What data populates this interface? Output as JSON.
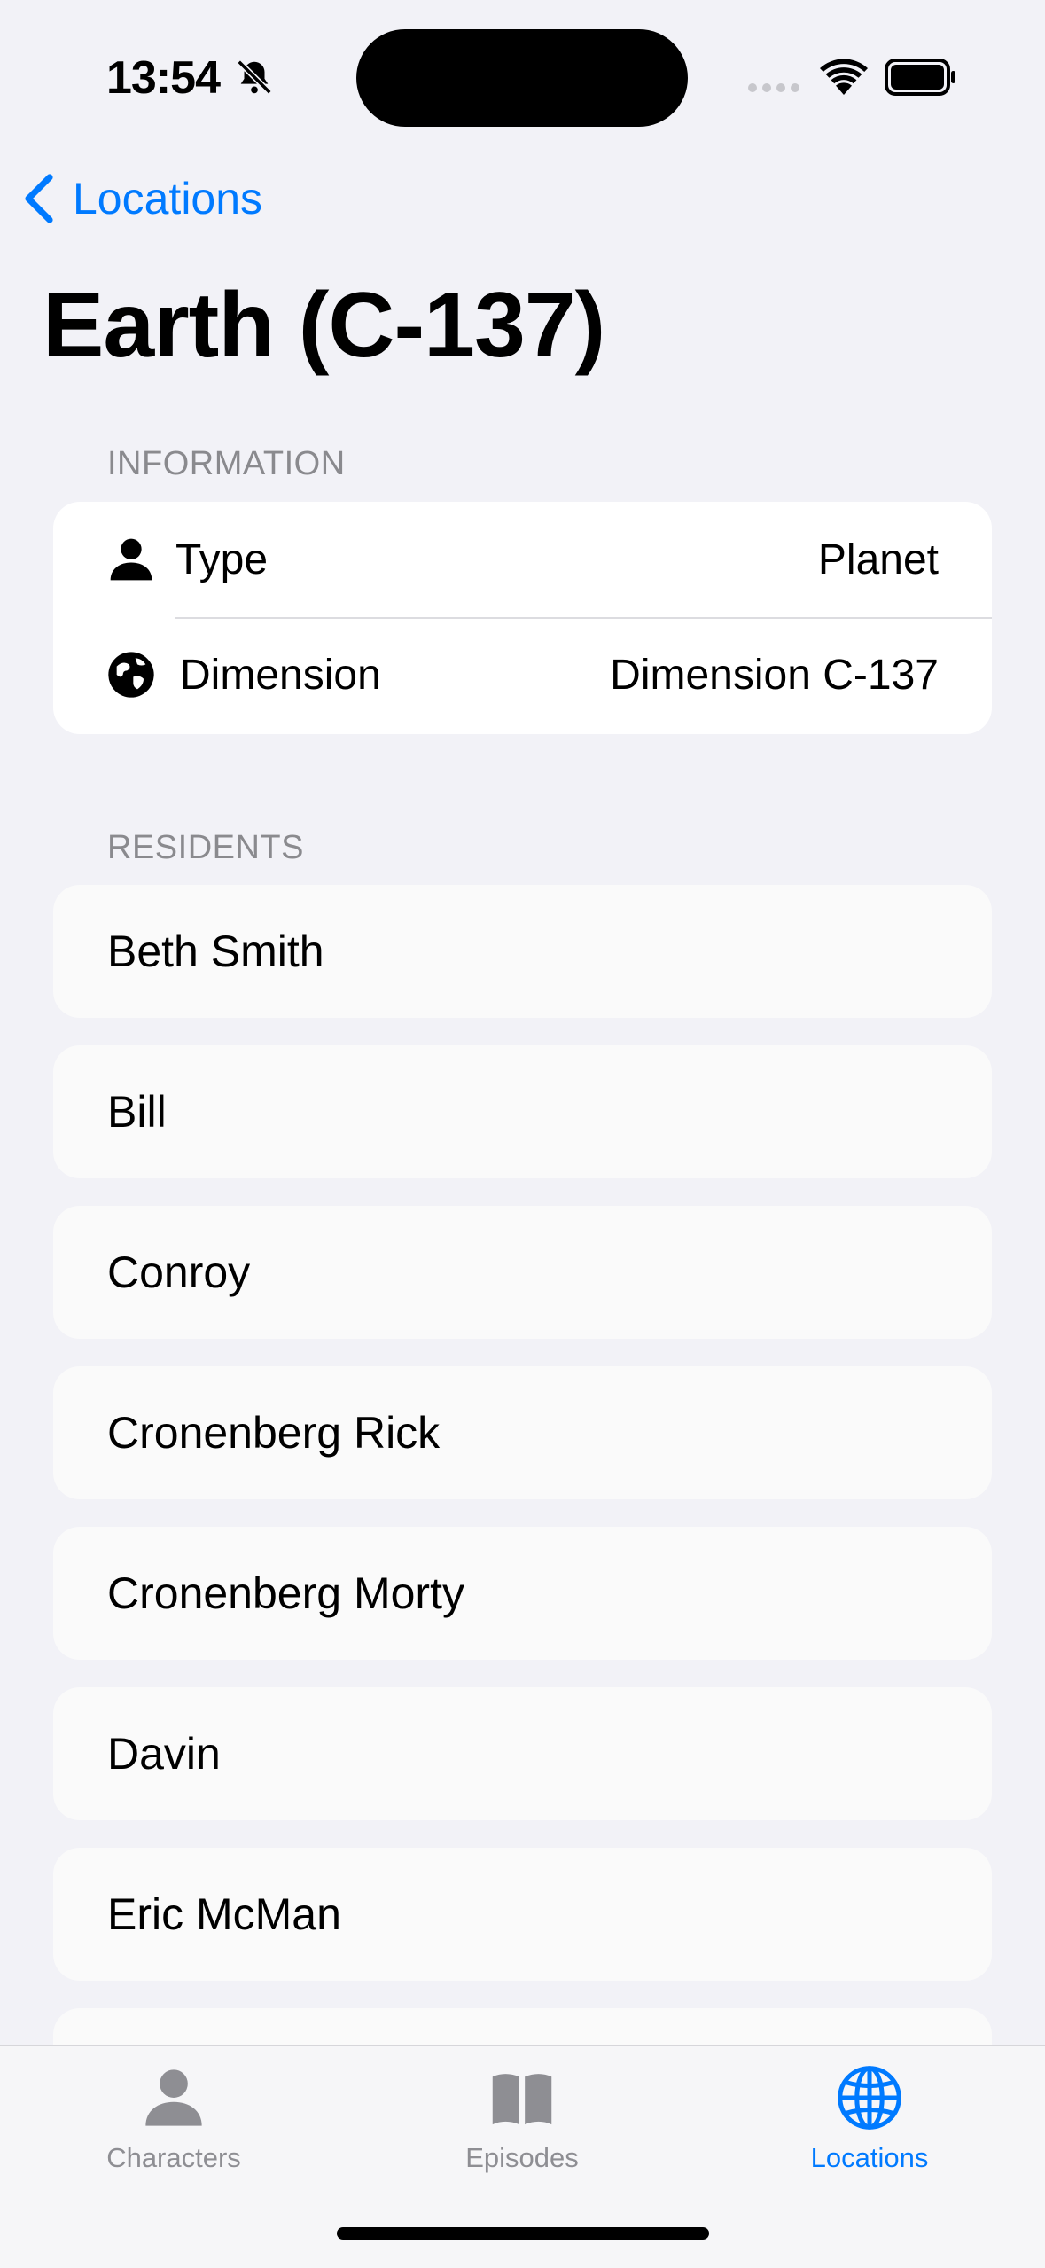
{
  "status_bar": {
    "time": "13:54"
  },
  "nav": {
    "back_label": "Locations",
    "title": "Earth (C-137)"
  },
  "information": {
    "header": "INFORMATION",
    "rows": [
      {
        "icon": "person-icon",
        "label": "Type",
        "value": "Planet"
      },
      {
        "icon": "globe-icon",
        "label": "Dimension",
        "value": "Dimension C-137"
      }
    ]
  },
  "residents": {
    "header": "RESIDENTS",
    "items": [
      "Beth Smith",
      "Bill",
      "Conroy",
      "Cronenberg Rick",
      "Cronenberg Morty",
      "Davin",
      "Eric McMan"
    ]
  },
  "tab_bar": {
    "tabs": [
      {
        "label": "Characters",
        "icon": "person-icon",
        "active": false
      },
      {
        "label": "Episodes",
        "icon": "book-icon",
        "active": false
      },
      {
        "label": "Locations",
        "icon": "globe-icon",
        "active": true
      }
    ]
  },
  "colors": {
    "accent": "#007aff",
    "background": "#f2f2f7",
    "secondary_text": "#8e8e93"
  }
}
